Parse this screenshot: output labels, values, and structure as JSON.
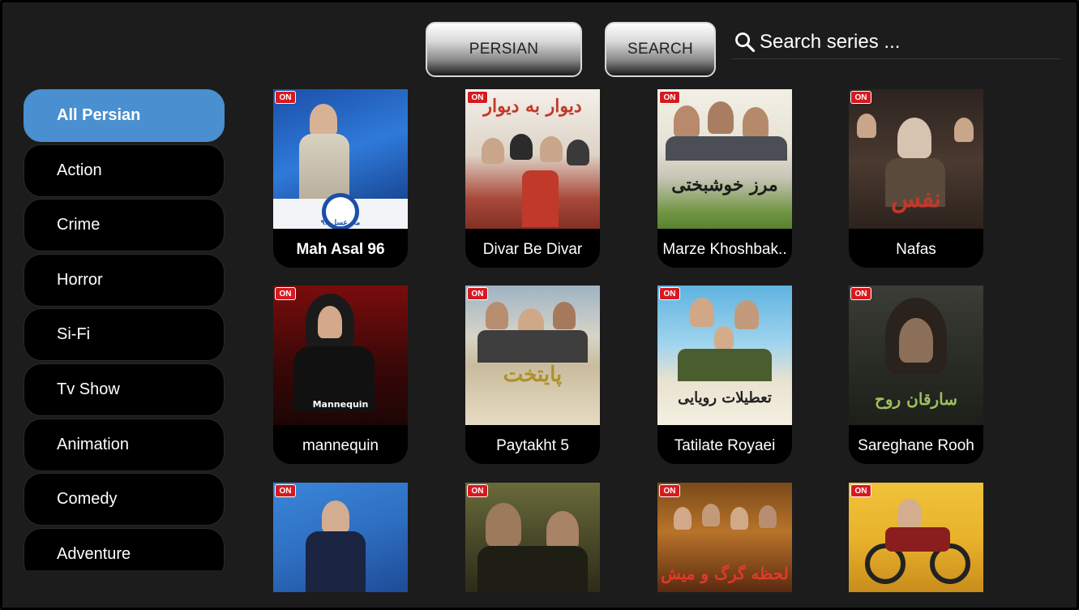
{
  "header": {
    "persian_label": "PERSIAN",
    "search_label": "SEARCH",
    "search_placeholder": "Search series ..."
  },
  "sidebar": {
    "items": [
      {
        "label": "All Persian",
        "active": true
      },
      {
        "label": "Action"
      },
      {
        "label": "Crime"
      },
      {
        "label": "Horror"
      },
      {
        "label": "Si-Fi"
      },
      {
        "label": "Tv Show"
      },
      {
        "label": "Animation"
      },
      {
        "label": "Comedy"
      },
      {
        "label": "Adventure"
      }
    ]
  },
  "grid": {
    "items": [
      {
        "title": "Mah Asal 96",
        "poster_text": "ماه عسل ۹۶",
        "badge": "ON"
      },
      {
        "title": "Divar Be Divar",
        "poster_text": "دیوار به دیوار",
        "badge": "ON"
      },
      {
        "title": "Marze Khoshbak..",
        "poster_text": "مرز خوشبختی",
        "badge": "ON"
      },
      {
        "title": "Nafas",
        "poster_text": "نفس",
        "badge": "ON"
      },
      {
        "title": "mannequin",
        "poster_text": "Mannequin",
        "badge": "ON"
      },
      {
        "title": "Paytakht 5",
        "poster_text": "پایتخت",
        "badge": "ON"
      },
      {
        "title": "Tatilate Royaei",
        "poster_text": "تعطیلات رویایی",
        "badge": "ON"
      },
      {
        "title": "Sareghane Rooh",
        "poster_text": "سارقان روح",
        "badge": "ON"
      },
      {
        "title": "",
        "poster_text": "",
        "badge": "ON"
      },
      {
        "title": "",
        "poster_text": "",
        "badge": "ON"
      },
      {
        "title": "",
        "poster_text": "لحظه گرگ و میش",
        "badge": "ON"
      },
      {
        "title": "",
        "poster_text": "",
        "badge": "ON"
      }
    ]
  },
  "colors": {
    "accent": "#4a8fcf",
    "background": "#1c1c1c",
    "badge": "#d71920"
  },
  "icons": {
    "search": "search-icon"
  }
}
